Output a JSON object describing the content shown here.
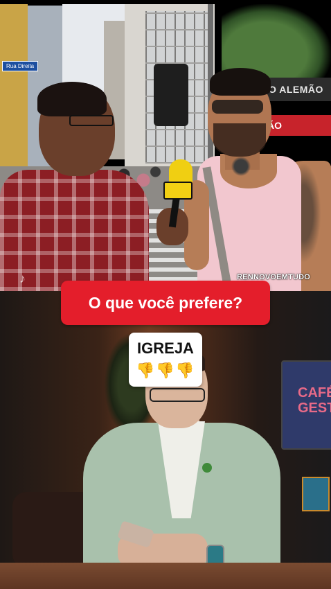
{
  "top_clip": {
    "street_sign": "Rua Direita",
    "shop_sign": "O ALEMÃO",
    "shop_sign_red": "ÃO",
    "watermark": "RENNOVOEMTUDO"
  },
  "overlay": {
    "question": "O que você prefere?",
    "answer": {
      "label": "IGREJA",
      "reaction": "👎👎👎",
      "reaction_icon": "thumbs-down-icon"
    }
  },
  "bottom_clip": {
    "screen_text": "CAFÉ GEST"
  },
  "colors": {
    "banner_red": "#e41e2b",
    "mic_yellow": "#f0cf12",
    "card_white": "#ffffff"
  }
}
